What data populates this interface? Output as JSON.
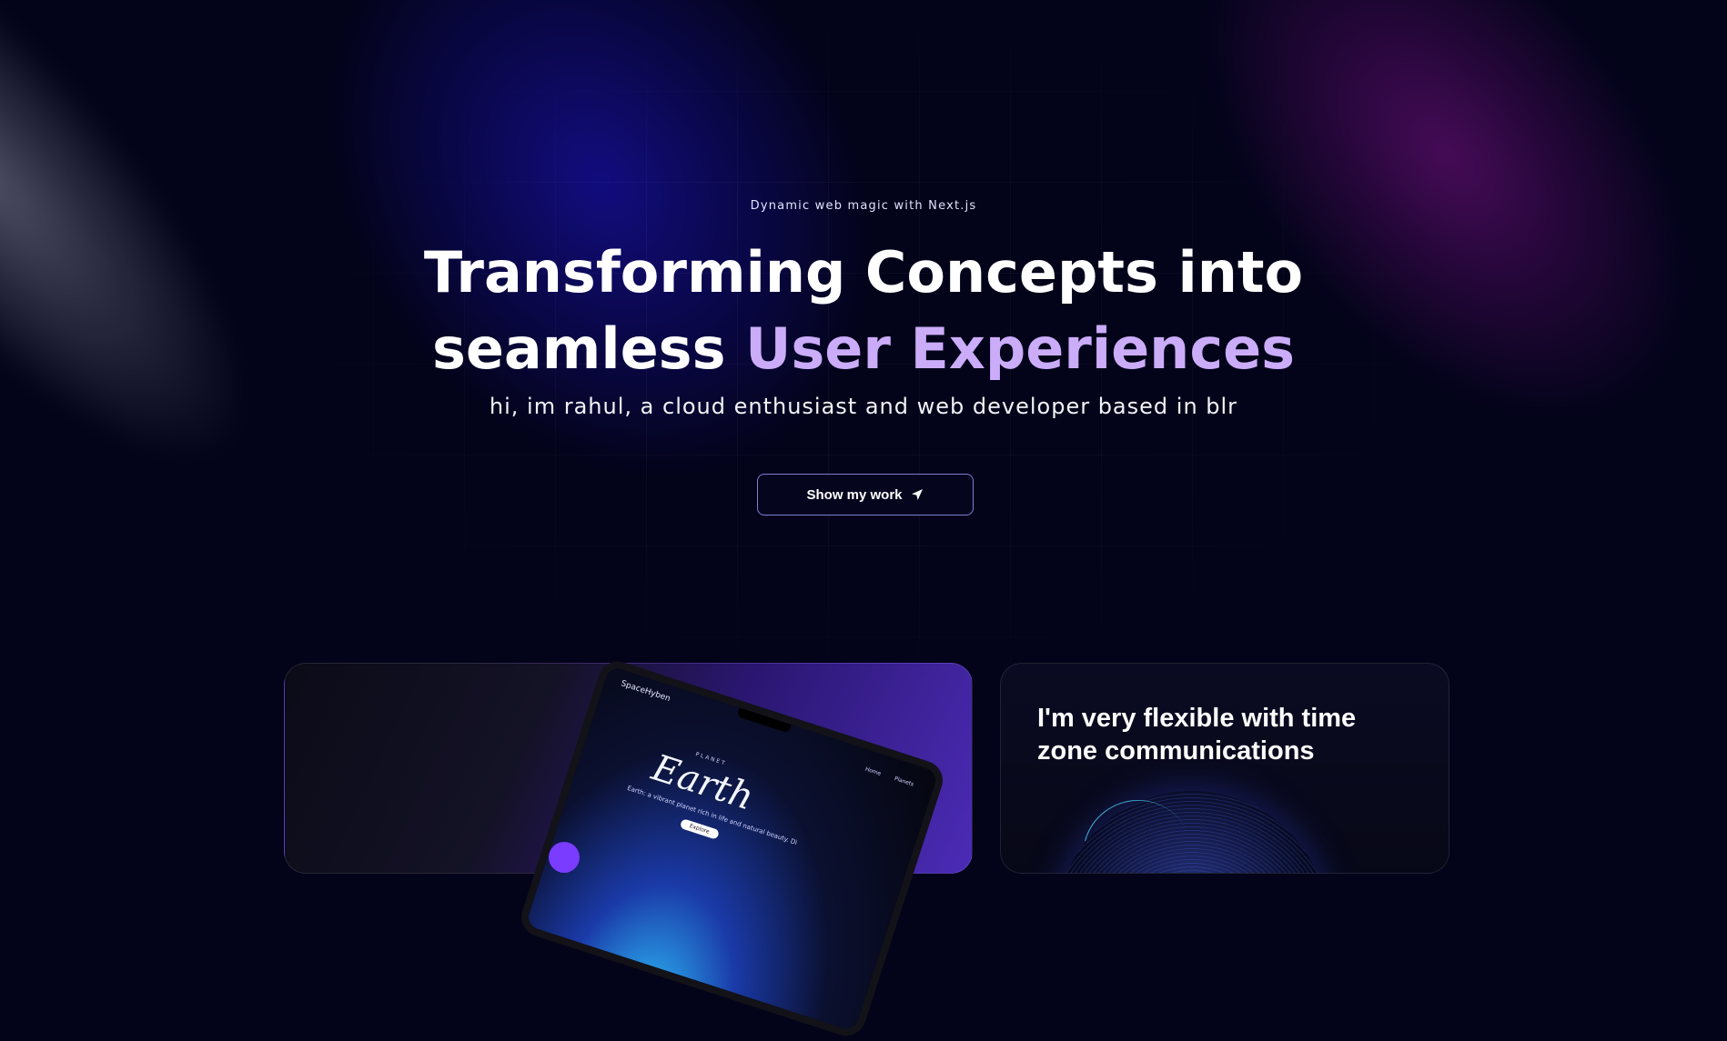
{
  "hero": {
    "eyebrow": "Dynamic web magic with Next.js",
    "headline_line1": "Transforming Concepts into",
    "headline_line2_plain": "seamless ",
    "headline_line2_accent": "User Experiences",
    "subline": "hi, im rahul, a cloud enthusiast and web developer based in blr",
    "cta_label": "Show my work",
    "cta_icon": "paper-plane-icon",
    "accent_color": "#cbacf9"
  },
  "project_card": {
    "brand": "SpaceHyben",
    "nav": [
      "Home",
      "Planets"
    ],
    "planet_label": "PLANET",
    "title": "Earth",
    "description": "Earth: a vibrant planet rich in life and natural beauty. Di",
    "button": "Explore"
  },
  "timezone_card": {
    "title": "I'm very flexible with time zone communications"
  }
}
